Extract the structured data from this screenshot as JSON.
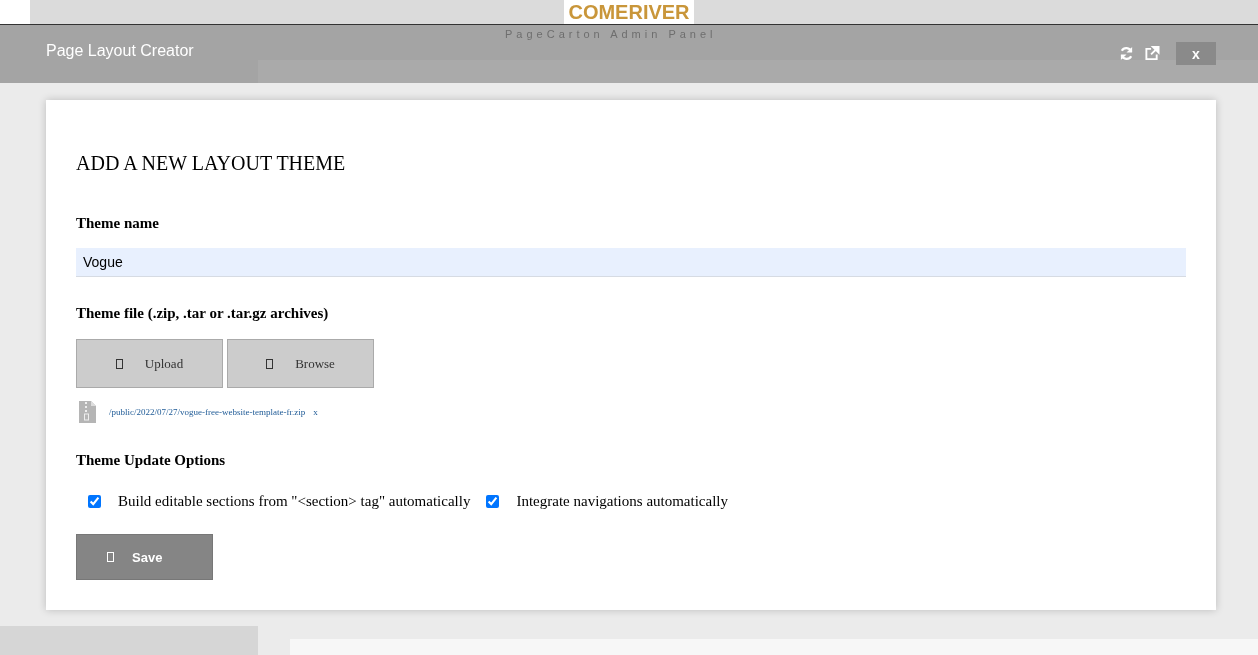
{
  "background": {
    "logo": "COMERIVER",
    "subtitle": "PageCarton Admin Panel"
  },
  "window": {
    "title": "Page Layout Creator",
    "close_label": "x"
  },
  "form": {
    "heading": "ADD A NEW LAYOUT THEME",
    "name_label": "Theme name",
    "name_value": "Vogue",
    "file_label": "Theme file (.zip, .tar or .tar.gz archives)",
    "file_buttons": [
      "Upload",
      "Browse"
    ],
    "file_path": "/public/2022/07/27/vogue-free-website-template-fr.zip",
    "file_remove": "x",
    "options_label": "Theme Update Options",
    "options": [
      {
        "label": "Build editable sections from \"<section> tag\" automatically",
        "checked": true
      },
      {
        "label": "Integrate navigations automatically",
        "checked": true
      }
    ],
    "submit": "Save"
  }
}
